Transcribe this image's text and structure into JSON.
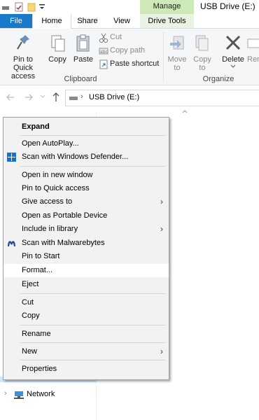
{
  "title_bar": {
    "manage": "Manage",
    "title": "USB Drive (E:)"
  },
  "tabs": {
    "file": "File",
    "home": "Home",
    "share": "Share",
    "view": "View",
    "drive_tools": "Drive Tools"
  },
  "ribbon": {
    "pin": "Pin to Quick access",
    "copy": "Copy",
    "paste": "Paste",
    "cut": "Cut",
    "copy_path": "Copy path",
    "paste_shortcut": "Paste shortcut",
    "clipboard": "Clipboard",
    "move_to": "Move to",
    "copy_to": "Copy to",
    "delete": "Delete",
    "rename": "Ren",
    "organize": "Organize"
  },
  "address": {
    "path": "USB Drive (E:)"
  },
  "context_menu": {
    "items": [
      "Expand",
      "Open AutoPlay...",
      "Scan with Windows Defender...",
      "Open in new window",
      "Pin to Quick access",
      "Give access to",
      "Open as Portable Device",
      "Include in library",
      "Scan with Malwarebytes",
      "Pin to Start",
      "Format...",
      "Eject",
      "Cut",
      "Copy",
      "Rename",
      "New",
      "Properties"
    ]
  },
  "nav_pane": {
    "network": "Network"
  },
  "colors": {
    "file_tab": "#1979ca",
    "manage_tab": "#cde9b7",
    "menu_bg": "#f2f2f2",
    "selection": "#cce8ff"
  }
}
